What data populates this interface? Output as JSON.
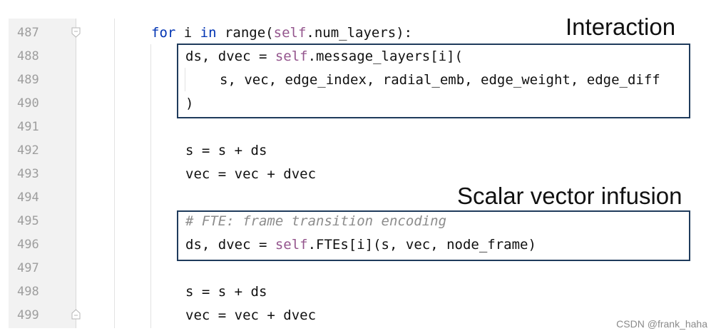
{
  "editor": {
    "line_numbers": [
      "487",
      "488",
      "489",
      "490",
      "491",
      "492",
      "493",
      "494",
      "495",
      "496",
      "497",
      "498",
      "499"
    ],
    "code": {
      "l487": {
        "kw1": "for",
        "var": " i ",
        "kw2": "in",
        "fn": " range(",
        "self": "self",
        "rest": ".num_layers):"
      },
      "l488": {
        "pre": "ds, dvec = ",
        "self": "self",
        "rest": ".message_layers[i]("
      },
      "l489": {
        "text": "s, vec, edge_index, radial_emb, edge_weight, edge_diff"
      },
      "l490": {
        "text": ")"
      },
      "l492": {
        "text": "s = s + ds"
      },
      "l493": {
        "text": "vec = vec + dvec"
      },
      "l495": {
        "text": "# FTE: frame transition encoding"
      },
      "l496": {
        "pre": "ds, dvec = ",
        "self": "self",
        "rest": ".FTEs[i](s, vec, node_frame)"
      },
      "l498": {
        "text": "s = s + ds"
      },
      "l499": {
        "text": "vec = vec + dvec"
      }
    }
  },
  "annotations": {
    "interaction": "Interaction",
    "scalar_vector_infusion": "Scalar vector infusion"
  },
  "watermark": "CSDN @frank_haha",
  "colors": {
    "keyword": "#0033b3",
    "self": "#94558d",
    "comment": "#8c8c8c",
    "box_border": "#1f3b5c",
    "gutter_bg": "#f2f2f2",
    "line_number": "#9e9e9e"
  }
}
